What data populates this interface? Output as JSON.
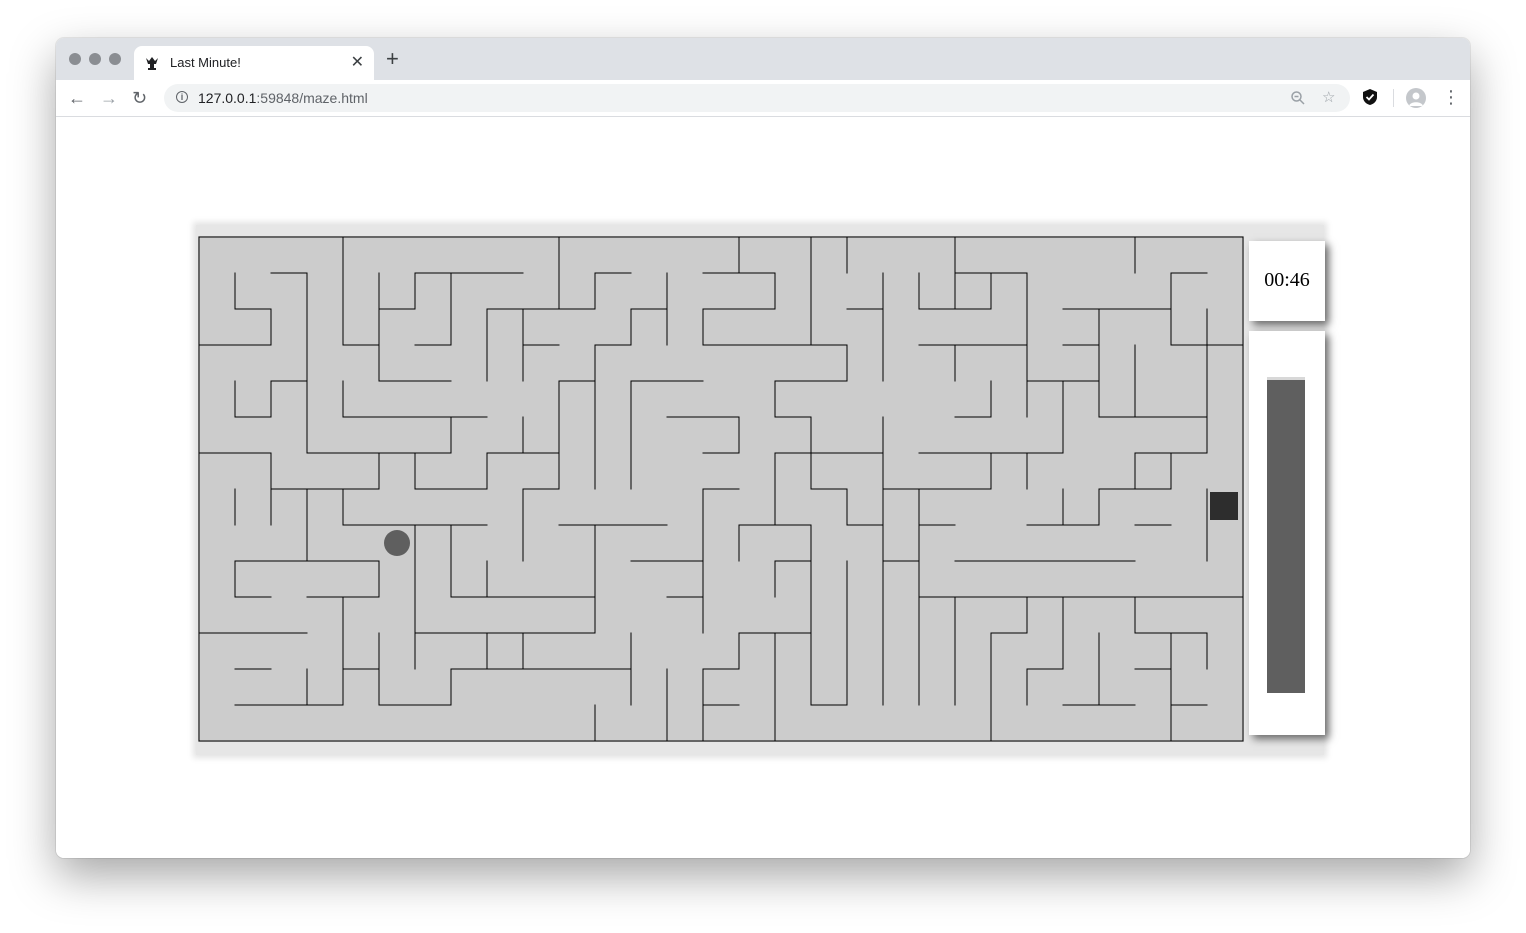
{
  "browser": {
    "tab_title": "Last Minute!",
    "tab_icon": "crown-piece-icon",
    "url_host": "127.0.0.1",
    "url_rest": ":59848/maze.html"
  },
  "game": {
    "timer": "00:46",
    "time_meter_fraction": 0.99,
    "maze_grid": {
      "cols": 29,
      "rows": 14
    },
    "player_cell": {
      "col": 5,
      "row": 9
    },
    "goal_cell": {
      "col": 28,
      "row": 7
    },
    "colors": {
      "maze_floor": "#cccccc",
      "wall": "#000000",
      "player": "#5f5f5f",
      "goal": "#2d2d2d",
      "meter_fill": "#5f5f5f"
    }
  }
}
